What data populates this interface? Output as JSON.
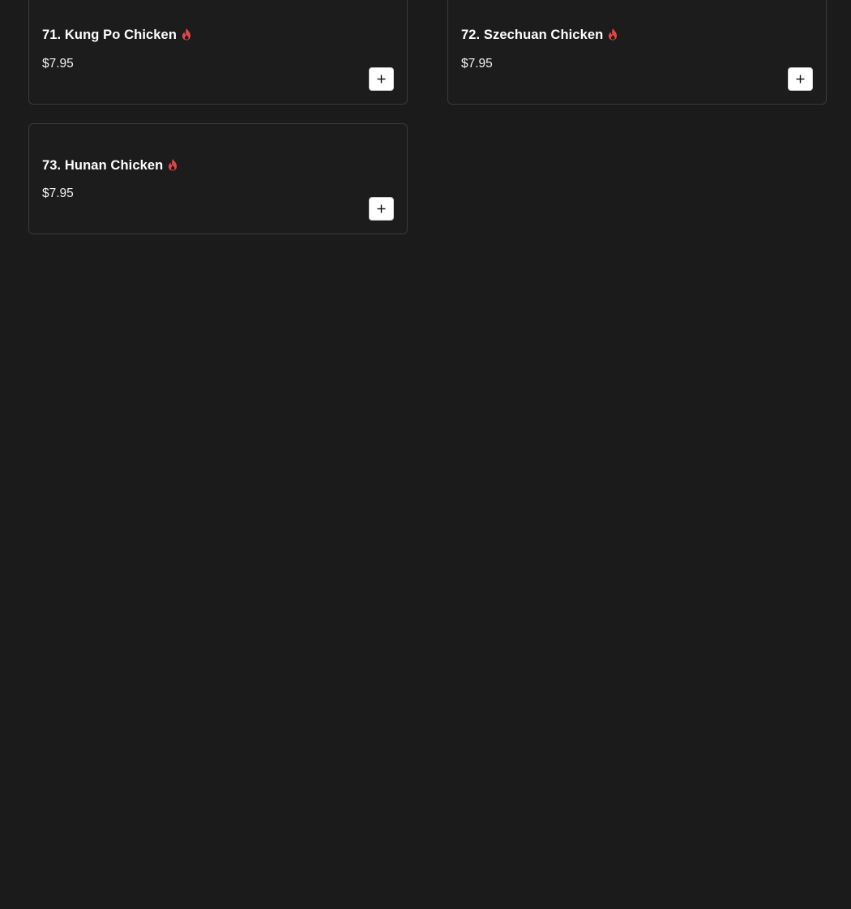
{
  "menu": {
    "items": [
      {
        "name": "71. Kung Po Chicken",
        "price": "$7.95",
        "spicy": true,
        "spicy_icon": "flame-icon",
        "add_icon": "plus-icon"
      },
      {
        "name": "72. Szechuan Chicken",
        "price": "$7.95",
        "spicy": true,
        "spicy_icon": "flame-icon",
        "add_icon": "plus-icon"
      },
      {
        "name": "73. Hunan Chicken",
        "price": "$7.95",
        "spicy": true,
        "spicy_icon": "flame-icon",
        "add_icon": "plus-icon"
      }
    ]
  },
  "colors": {
    "background": "#1b1b1b",
    "card_border": "#3a3a3a",
    "text": "#ffffff",
    "spicy": "#e04848",
    "button_bg": "#ffffff",
    "button_icon": "#111111"
  }
}
